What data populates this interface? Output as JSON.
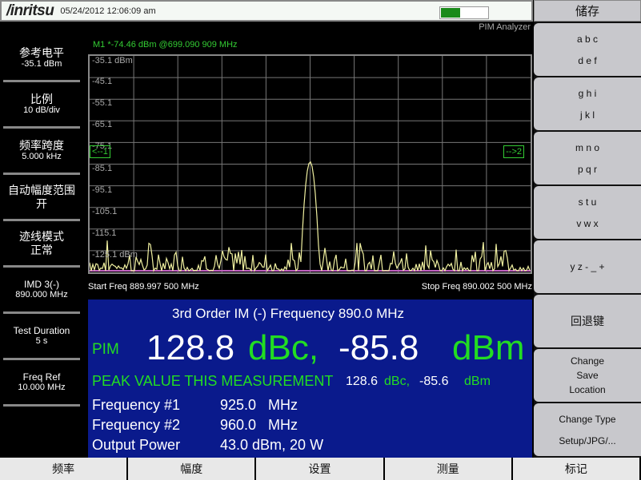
{
  "header": {
    "brand": "/inritsu",
    "datetime": "05/24/2012 12:06:09 am",
    "battery_level": 0.4,
    "mode": "PIM Analyzer"
  },
  "left": [
    {
      "title": "参考电平",
      "value": "-35.1 dBm"
    },
    {
      "title": "比例",
      "value": "10 dB/div"
    },
    {
      "title": "频率跨度",
      "value": "5.000 kHz"
    },
    {
      "title": "自动幅度范围",
      "value": "开"
    },
    {
      "title": "迹线模式",
      "value": "正常"
    },
    {
      "title": "IMD 3(-)",
      "value": "890.000 MHz"
    },
    {
      "title": "Test Duration",
      "value": "5 s"
    },
    {
      "title": "Freq Ref",
      "value": "10.000 MHz"
    }
  ],
  "marker": "M1 *-74.46 dBm @699.090 909 MHz",
  "chart": {
    "ref_label": "-35.1 dBm",
    "y_labels": [
      "-45.1",
      "-55.1",
      "-65.1",
      "-75.1",
      "-85.1",
      "-95.1",
      "-105.1",
      "-115.1",
      "-125.1 dBm"
    ],
    "ylim": [
      -135.1,
      -35.1
    ],
    "xlim": [
      889.9975,
      890.0025
    ],
    "peak_freq": 890.0,
    "peak_dbm": -84,
    "arrow_left": "<--1",
    "arrow_right": "-->2",
    "start": "Start Freq 889.997 500 MHz",
    "stop": "Stop Freq 890.002 500 MHz",
    "trace_color": "#f0f0a0",
    "floor_color": "#c060c0"
  },
  "panel": {
    "im_title": "3rd Order IM (-) Frequency  890.0 MHz",
    "pim_label": "PIM",
    "pim_dbc": "128.8",
    "dbc_unit": "dBc,",
    "pim_dbm": "-85.8",
    "dbm_unit": "dBm",
    "peak_label": "PEAK VALUE THIS MEASUREMENT",
    "peak_dbc": "128.6",
    "peak_dbc_unit": "dBc,",
    "peak_dbm": "-85.6",
    "peak_dbm_unit": "dBm",
    "rows": [
      {
        "label": "Frequency #1",
        "value": "925.0   MHz"
      },
      {
        "label": "Frequency #2",
        "value": "960.0   MHz"
      },
      {
        "label": "Output Power",
        "value": "43.0 dBm, 20 W"
      }
    ]
  },
  "right": {
    "title": "储存",
    "buttons": [
      [
        "a b c",
        "d e f"
      ],
      [
        "g h i",
        "j k l"
      ],
      [
        "m n o",
        "p q r"
      ],
      [
        "s t u",
        "v w x"
      ],
      [
        "y z - _ +"
      ],
      [
        "回退键"
      ],
      [
        "Change",
        "Save",
        "Location"
      ],
      [
        "Change Type",
        "Setup/JPG/..."
      ]
    ]
  },
  "bottom": [
    "频率",
    "幅度",
    "设置",
    "测量",
    "标记"
  ]
}
